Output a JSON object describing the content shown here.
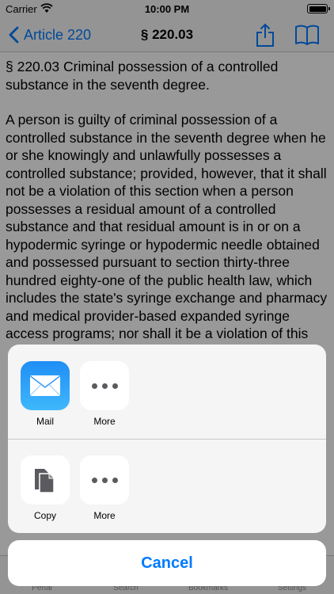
{
  "status_bar": {
    "carrier": "Carrier",
    "time": "10:00 PM"
  },
  "nav": {
    "back_label": "Article 220",
    "title": "§ 220.03"
  },
  "content": {
    "heading": "§ 220.03 Criminal possession of a controlled substance in the seventh degree.",
    "body": "A person is guilty of criminal possession of a controlled substance in the seventh degree when he or she knowingly and unlawfully possesses a controlled substance; provided, however, that it shall not be a violation of this section when a person possesses a residual amount of a controlled substance and that residual amount is in or on a hypodermic syringe or hypodermic needle obtained and possessed pursuant to section thirty-three hundred eighty-one of the public health law, which includes the state's syringe exchange and pharmacy and medical provider-based expanded syringe access programs; nor shall it be a violation of this"
  },
  "tab_bar": {
    "items": [
      "Penal",
      "Search",
      "Bookmarks",
      "Settings"
    ]
  },
  "share_sheet": {
    "row1": [
      {
        "label": "Mail",
        "icon": "mail-icon"
      },
      {
        "label": "More",
        "icon": "more-icon"
      }
    ],
    "row2": [
      {
        "label": "Copy",
        "icon": "copy-icon"
      },
      {
        "label": "More",
        "icon": "more-icon"
      }
    ],
    "cancel_label": "Cancel"
  },
  "colors": {
    "accent": "#007aff",
    "mail_gradient_top": "#1f8ef5",
    "mail_gradient_bottom": "#3fb8fb"
  }
}
